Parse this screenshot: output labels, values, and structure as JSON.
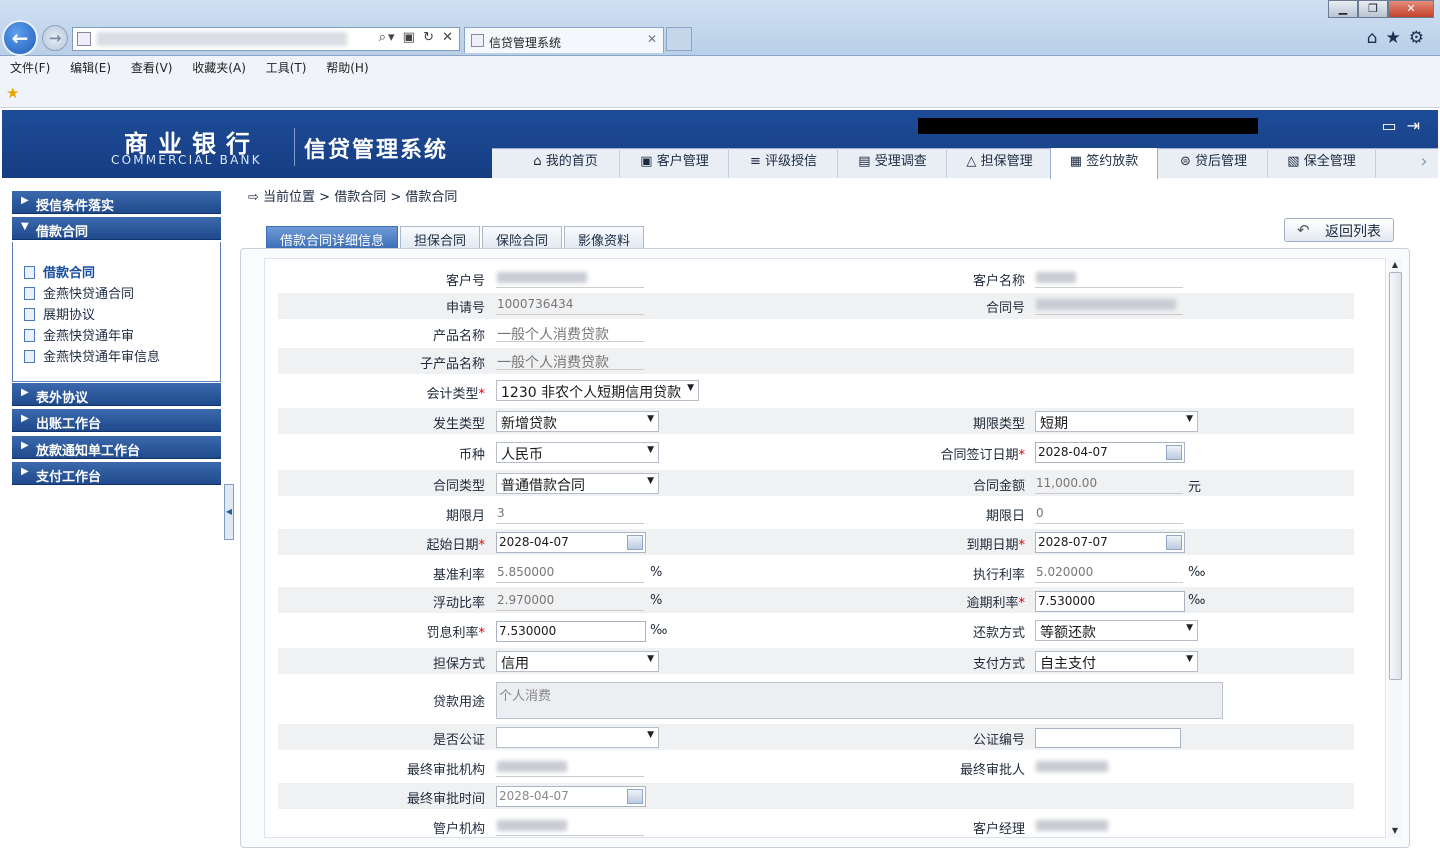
{
  "browser": {
    "tab_title": "信贷管理系统",
    "menu": [
      "文件(F)",
      "编辑(E)",
      "查看(V)",
      "收藏夹(A)",
      "工具(T)",
      "帮助(H)"
    ]
  },
  "header": {
    "logo_cn": "商业银行",
    "logo_en": "COMMERCIAL BANK",
    "system_title": "信贷管理系统",
    "nav_tabs": [
      "我的首页",
      "客户管理",
      "评级授信",
      "受理调查",
      "担保管理",
      "签约放款",
      "贷后管理",
      "保全管理"
    ],
    "active_nav": "签约放款"
  },
  "sidebar": {
    "sections": [
      "授信条件落实",
      "借款合同",
      "表外协议",
      "出账工作台",
      "放款通知单工作台",
      "支付工作台"
    ],
    "items": [
      "借款合同",
      "金燕快贷通合同",
      "展期协议",
      "金燕快贷通年审",
      "金燕快贷通年审信息"
    ],
    "selected_item": "借款合同"
  },
  "breadcrumb": "当前位置 > 借款合同 > 借款合同",
  "content_tabs": [
    "借款合同详细信息",
    "担保合同",
    "保险合同",
    "影像资料"
  ],
  "back_button": "返回列表",
  "form": {
    "customer_no_label": "客户号",
    "customer_name_label": "客户名称",
    "apply_no_label": "申请号",
    "apply_no": "1000736434",
    "contract_no_label": "合同号",
    "product_label": "产品名称",
    "product": "一般个人消费贷款",
    "sub_product_label": "子产品名称",
    "sub_product": "一般个人消费贷款",
    "acct_type_label": "会计类型",
    "acct_type": "1230 非农个人短期信用贷款",
    "occur_type_label": "发生类型",
    "occur_type": "新增贷款",
    "term_type_label": "期限类型",
    "term_type": "短期",
    "currency_label": "币种",
    "currency": "人民币",
    "sign_date_label": "合同签订日期",
    "sign_date": "2028-04-07",
    "contract_type_label": "合同类型",
    "contract_type": "普通借款合同",
    "amount_label": "合同金额",
    "amount": "11,000.00",
    "amount_unit": "元",
    "term_month_label": "期限月",
    "term_month": "3",
    "term_day_label": "期限日",
    "term_day": "0",
    "start_date_label": "起始日期",
    "start_date": "2028-04-07",
    "end_date_label": "到期日期",
    "end_date": "2028-07-07",
    "base_rate_label": "基准利率",
    "base_rate": "5.850000",
    "base_rate_unit": "%",
    "exec_rate_label": "执行利率",
    "exec_rate": "5.020000",
    "exec_rate_unit": "‰",
    "float_ratio_label": "浮动比率",
    "float_ratio": "2.970000",
    "float_ratio_unit": "%",
    "overdue_rate_label": "逾期利率",
    "overdue_rate": "7.530000",
    "overdue_rate_unit": "‰",
    "penalty_rate_label": "罚息利率",
    "penalty_rate": "7.530000",
    "penalty_rate_unit": "‰",
    "repay_label": "还款方式",
    "repay": "等额还款",
    "guarantee_label": "担保方式",
    "guarantee": "信用",
    "pay_label": "支付方式",
    "pay": "自主支付",
    "purpose_label": "贷款用途",
    "purpose": "个人消费",
    "notarize_label": "是否公证",
    "notarize": "",
    "notary_no_label": "公证编号",
    "final_org_label": "最终审批机构",
    "final_person_label": "最终审批人",
    "final_time_label": "最终审批时间",
    "final_time": "2028-04-07",
    "mgr_org_label": "管户机构",
    "cust_mgr_label": "客户经理"
  }
}
